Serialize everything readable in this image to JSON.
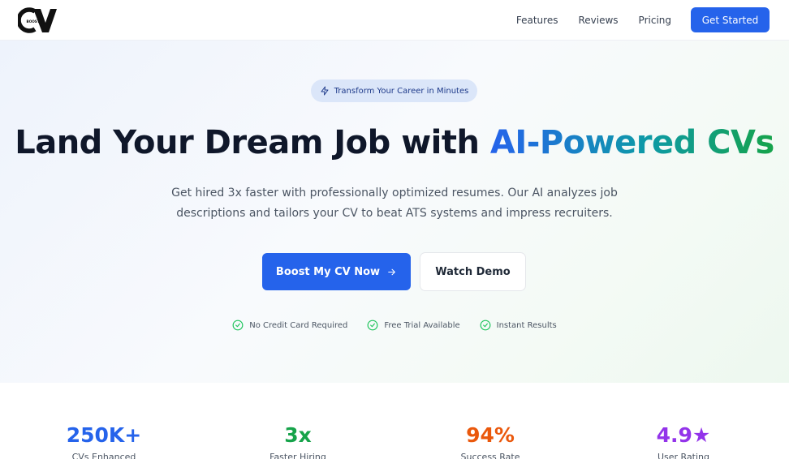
{
  "nav": {
    "logo_text": "CV",
    "logo_subtext": "BOOST",
    "links": [
      "Features",
      "Reviews",
      "Pricing"
    ],
    "cta_label": "Get Started"
  },
  "hero": {
    "badge_icon": "lightning-icon",
    "badge_text": "Transform Your Career in Minutes",
    "headline_plain": "Land Your Dream Job with ",
    "headline_highlight": "AI-Powered CVs",
    "subtext": "Get hired 3x faster with professionally optimized resumes. Our AI analyzes job descriptions and tailors your CV to beat ATS systems and impress recruiters.",
    "primary_button": "Boost My CV Now",
    "primary_button_icon": "arrow-right-icon",
    "secondary_button": "Watch Demo",
    "features": [
      {
        "icon": "check-circle-icon",
        "label": "No Credit Card Required"
      },
      {
        "icon": "check-circle-icon",
        "label": "Free Trial Available"
      },
      {
        "icon": "check-circle-icon",
        "label": "Instant Results"
      }
    ]
  },
  "stats": [
    {
      "value": "250K+",
      "label": "CVs Enhanced",
      "color": "#2563eb"
    },
    {
      "value": "3x",
      "label": "Faster Hiring",
      "color": "#16a34a"
    },
    {
      "value": "94%",
      "label": "Success Rate",
      "color": "#ea580c"
    },
    {
      "value": "4.9★",
      "label": "User Rating",
      "color": "#9333ea"
    }
  ],
  "colors": {
    "primary": "#2563eb",
    "check": "#22c55e",
    "heading": "#0f172a"
  }
}
